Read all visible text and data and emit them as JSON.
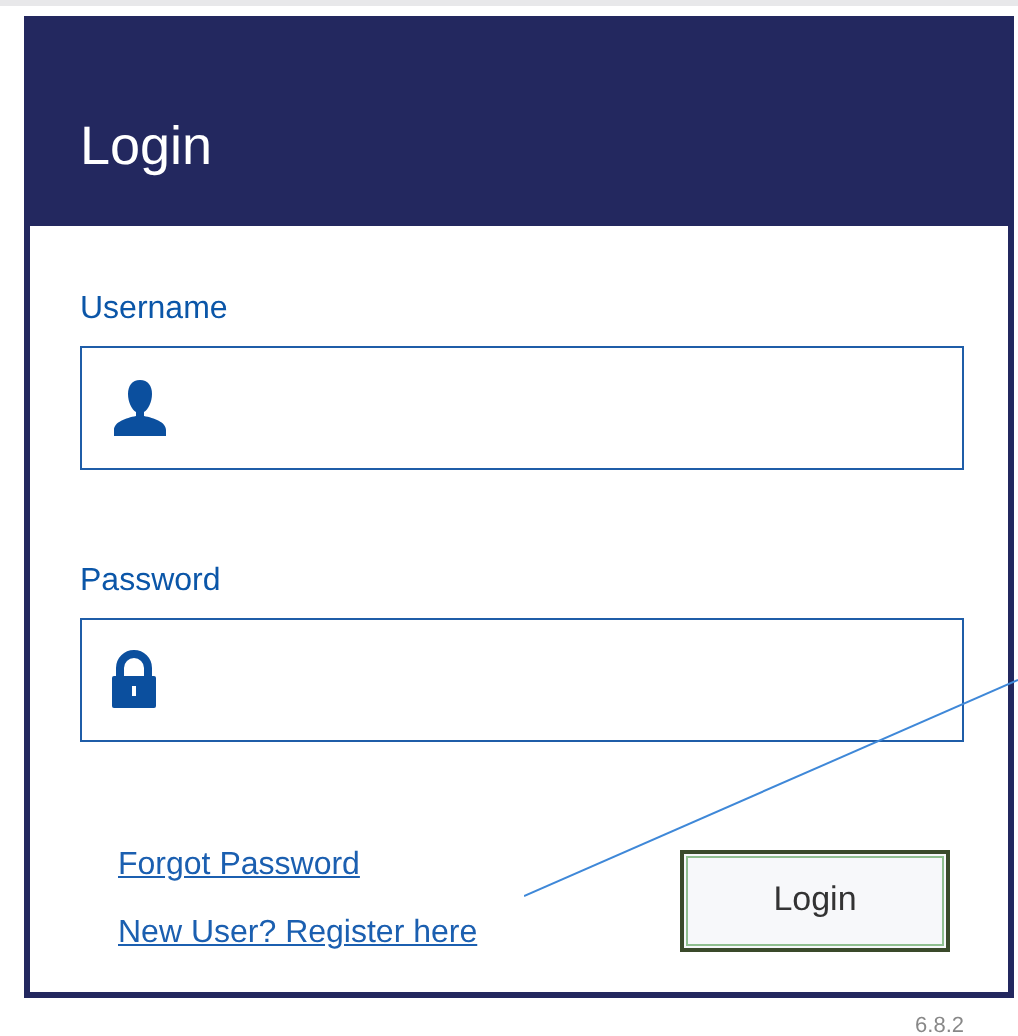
{
  "dialog": {
    "title": "Login"
  },
  "fields": [
    {
      "label": "Username",
      "kind": "user"
    },
    {
      "label": "Password",
      "kind": "password"
    }
  ],
  "links": [
    "Forgot Password",
    "New User? Register here"
  ],
  "login_button": {
    "label": "Login"
  },
  "version": "6.8.2"
}
